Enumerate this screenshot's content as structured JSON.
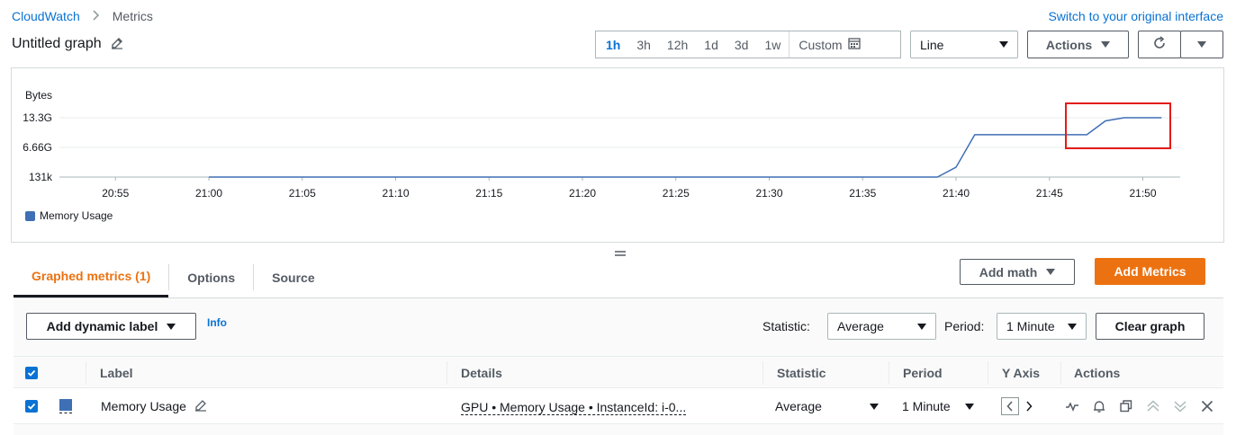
{
  "breadcrumb": {
    "root": "CloudWatch",
    "current": "Metrics"
  },
  "switch_link": "Switch to your original interface",
  "title": "Untitled graph",
  "time_range": {
    "options": [
      "1h",
      "3h",
      "12h",
      "1d",
      "3d",
      "1w"
    ],
    "selected": "1h",
    "custom_label": "Custom"
  },
  "chart_type_select": "Line",
  "actions_label": "Actions",
  "chart_data": {
    "type": "line",
    "ylabel": "Bytes",
    "y_ticks": [
      "131k",
      "6.66G",
      "13.3G"
    ],
    "x_ticks": [
      "20:55",
      "21:00",
      "21:05",
      "21:10",
      "21:15",
      "21:20",
      "21:25",
      "21:30",
      "21:35",
      "21:40",
      "21:45",
      "21:50"
    ],
    "series": [
      {
        "name": "Memory Usage",
        "color": "#3f6fb4",
        "points": [
          [
            "21:00",
            0.000131
          ],
          [
            "21:39",
            0.000131
          ],
          [
            "21:40",
            2.2
          ],
          [
            "21:41",
            9.5
          ],
          [
            "21:47",
            9.5
          ],
          [
            "21:48",
            12.6
          ],
          [
            "21:49",
            13.3
          ],
          [
            "21:51",
            13.3
          ]
        ]
      }
    ],
    "ylim_gb": [
      0,
      13.3
    ],
    "x_range": [
      "20:52",
      "21:52"
    ],
    "grid": "horizontal",
    "legend": "bottom-left"
  },
  "tabs": [
    {
      "label": "Graphed metrics (1)",
      "active": true
    },
    {
      "label": "Options",
      "active": false
    },
    {
      "label": "Source",
      "active": false
    }
  ],
  "add_math_label": "Add math",
  "add_metrics_label": "Add Metrics",
  "add_dynamic_label": "Add dynamic label",
  "info_label": "Info",
  "statistic_label": "Statistic:",
  "statistic_value": "Average",
  "period_label": "Period:",
  "period_value": "1 Minute",
  "clear_graph_label": "Clear graph",
  "table": {
    "headers": {
      "label": "Label",
      "details": "Details",
      "statistic": "Statistic",
      "period": "Period",
      "y_axis": "Y Axis",
      "actions": "Actions"
    },
    "rows": [
      {
        "label": "Memory Usage",
        "details": "GPU • Memory Usage • InstanceId: i-0...",
        "statistic": "Average",
        "period": "1 Minute",
        "color": "#3f6fb4"
      }
    ]
  }
}
